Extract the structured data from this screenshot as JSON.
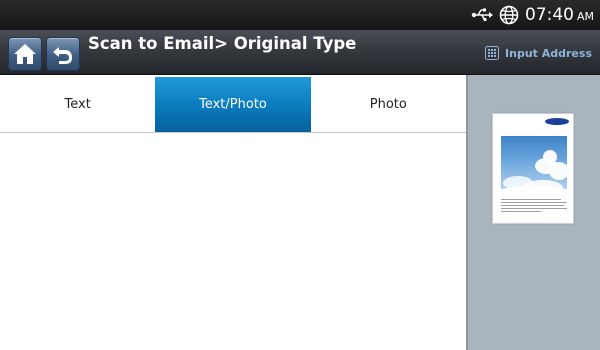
{
  "status": {
    "time": "07:40",
    "ampm": "AM",
    "usb_icon": "usb-icon",
    "network_icon": "globe-icon"
  },
  "header": {
    "title": "Scan to Email> Original Type",
    "home_icon": "home-icon",
    "back_icon": "back-icon",
    "input_address_label": "Input Address",
    "input_address_icon": "keypad-icon"
  },
  "tabs": [
    {
      "label": "Text",
      "selected": false
    },
    {
      "label": "Text/Photo",
      "selected": true
    },
    {
      "label": "Photo",
      "selected": false
    }
  ],
  "colors": {
    "active_tab": "#0b7dbf",
    "header_bg": "#34373c",
    "preview_bg": "#a9b4bf",
    "input_address_text": "#8fb3d9"
  }
}
